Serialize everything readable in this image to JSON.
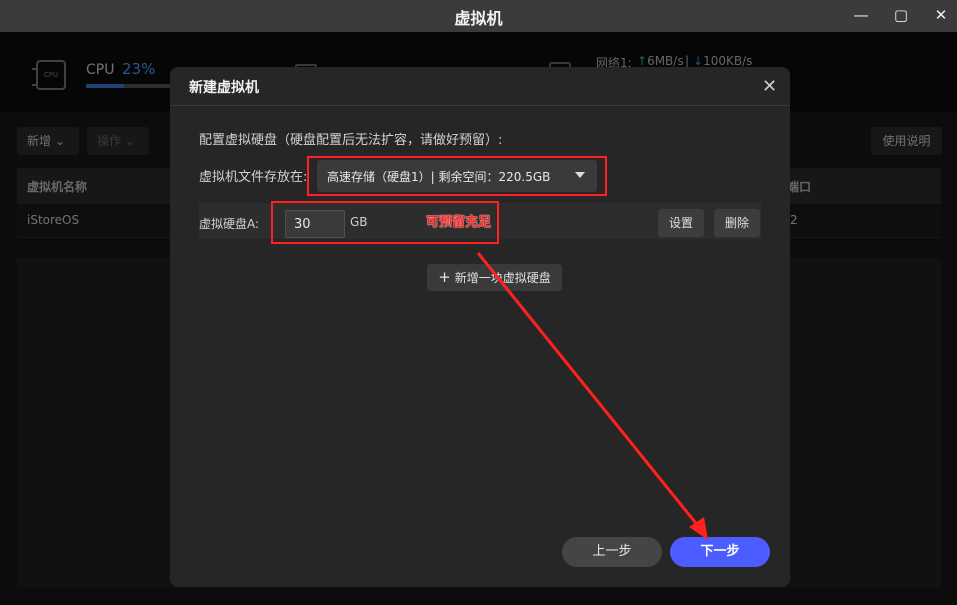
{
  "window": {
    "title": "虚拟机",
    "min_icon": "minimize-icon",
    "max_icon": "maximize-icon",
    "close_icon": "close-icon"
  },
  "stats": {
    "cpu_label": "CPU",
    "cpu_value": "23%",
    "cpu_fraction": 0.45,
    "net_label": "网络1:",
    "net_up": "6MB/s",
    "net_sep": "|",
    "net_down": "100KB/s",
    "up_arrow_color": "#3fbf5f",
    "down_arrow_color": "#4a90e2"
  },
  "toolbar": {
    "new_label": "新增",
    "ops_label": "操作",
    "help_label": "使用说明"
  },
  "table": {
    "col_name": "虚拟机名称",
    "col_port": "端口",
    "rows": [
      {
        "name": "iStoreOS",
        "port": "2"
      }
    ]
  },
  "modal": {
    "title": "新建虚拟机",
    "section_label": "配置虚拟硬盘（硬盘配置后无法扩容，请做好预留）:",
    "store_label": "虚拟机文件存放在:",
    "store_value": "高速存储（硬盘1）| 剩余空间：220.5GB",
    "disk_label": "虚拟硬盘A:",
    "disk_size": "30",
    "disk_unit": "GB",
    "note": "可预留充足",
    "set_label": "设置",
    "delete_label": "删除",
    "add_disk_label": "新增一块虚拟硬盘",
    "prev_label": "上一步",
    "next_label": "下一步",
    "accent_color": "#4b5dff",
    "annotation_color": "#ff2020"
  }
}
